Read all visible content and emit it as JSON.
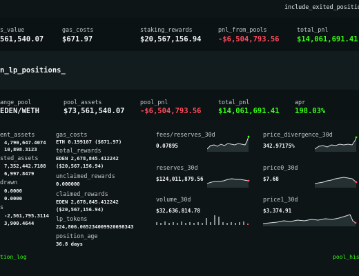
{
  "header": {
    "toggle_label": "include_exited_positio"
  },
  "summary": {
    "items": [
      {
        "label": "s_value",
        "value": "561,540.07",
        "tone": "neutral"
      },
      {
        "label": "gas_costs",
        "value": "$671.97",
        "tone": "neutral"
      },
      {
        "label": "staking_rewards",
        "value": "$20,567,156.94",
        "tone": "neutral"
      },
      {
        "label": "pnl_from_pools",
        "value": "-$6,504,793.56",
        "tone": "negative"
      },
      {
        "label": "total_pnl",
        "value": "$14,061,691.41",
        "tone": "positive"
      }
    ]
  },
  "section": {
    "title": "n_lp_positions_"
  },
  "pool_row": {
    "items": [
      {
        "label": "ange_pool",
        "value": "EDEN/WETH",
        "tone": "neutral"
      },
      {
        "label": "pool_assets",
        "value": "$73,561,540.07",
        "tone": "neutral"
      },
      {
        "label": "pool_pnl",
        "value": "-$6,504,793.56",
        "tone": "negative"
      },
      {
        "label": "total_pnl",
        "value": "$14,061,691.41",
        "tone": "positive"
      },
      {
        "label": "apr",
        "value": "198.03%",
        "tone": "positive"
      }
    ]
  },
  "details_col1": [
    {
      "label": "ent_assets",
      "values": [
        "4,790,647.4074",
        "10,898.3123"
      ]
    },
    {
      "label": "sted_assets",
      "values": [
        "7,352,442.7188",
        "6,997.8479"
      ]
    },
    {
      "label": "drawn",
      "values": [
        "0.0000",
        "0.0000"
      ]
    },
    {
      "label": "s",
      "values": [
        "-2,561,795.3114",
        "3,900.4644"
      ]
    }
  ],
  "details_col2": [
    {
      "label": "gas_costs",
      "values": [
        "ETH 0.199107 ($671.97)"
      ]
    },
    {
      "label": "total_rewards",
      "values": [
        "EDEN 2,678,845.412242",
        "($20,567,156.94)"
      ]
    },
    {
      "label": "unclaimed_rewards",
      "values": [
        "0.000000"
      ]
    },
    {
      "label": "claimed_rewards",
      "values": [
        "EDEN 2,678,845.412242",
        "($20,567,156.94)"
      ]
    },
    {
      "label": "lp_tokens",
      "values": [
        "224,806.065234009920698343"
      ]
    },
    {
      "label": "position_age",
      "values": [
        "36.8 days"
      ]
    }
  ],
  "metrics": [
    {
      "label": "fees/reserves_30d",
      "value": "0.07895",
      "chart": "line",
      "end_color": "#39ff14"
    },
    {
      "label": "price_divergence_30d",
      "value": "342.97175%",
      "chart": "line",
      "end_color": "#39ff14"
    },
    {
      "label": "reserves_30d",
      "value": "$124,011,879.56",
      "chart": "line",
      "end_color": "#ff4d5e"
    },
    {
      "label": "price0_30d",
      "value": "$7.68",
      "chart": "line",
      "end_color": "#ff4d5e"
    },
    {
      "label": "volume_30d",
      "value": "$32,636,814.78",
      "chart": "bars",
      "end_color": "#ff4d5e"
    },
    {
      "label": "price1_30d",
      "value": "$3,374.91",
      "chart": "line",
      "end_color": "#ff4d5e"
    }
  ],
  "footer": {
    "left_link": "tion_log",
    "right_link": "pool_his"
  },
  "colors": {
    "positive": "#39ff14",
    "negative": "#ff4d5e",
    "background": "#0d1517"
  }
}
